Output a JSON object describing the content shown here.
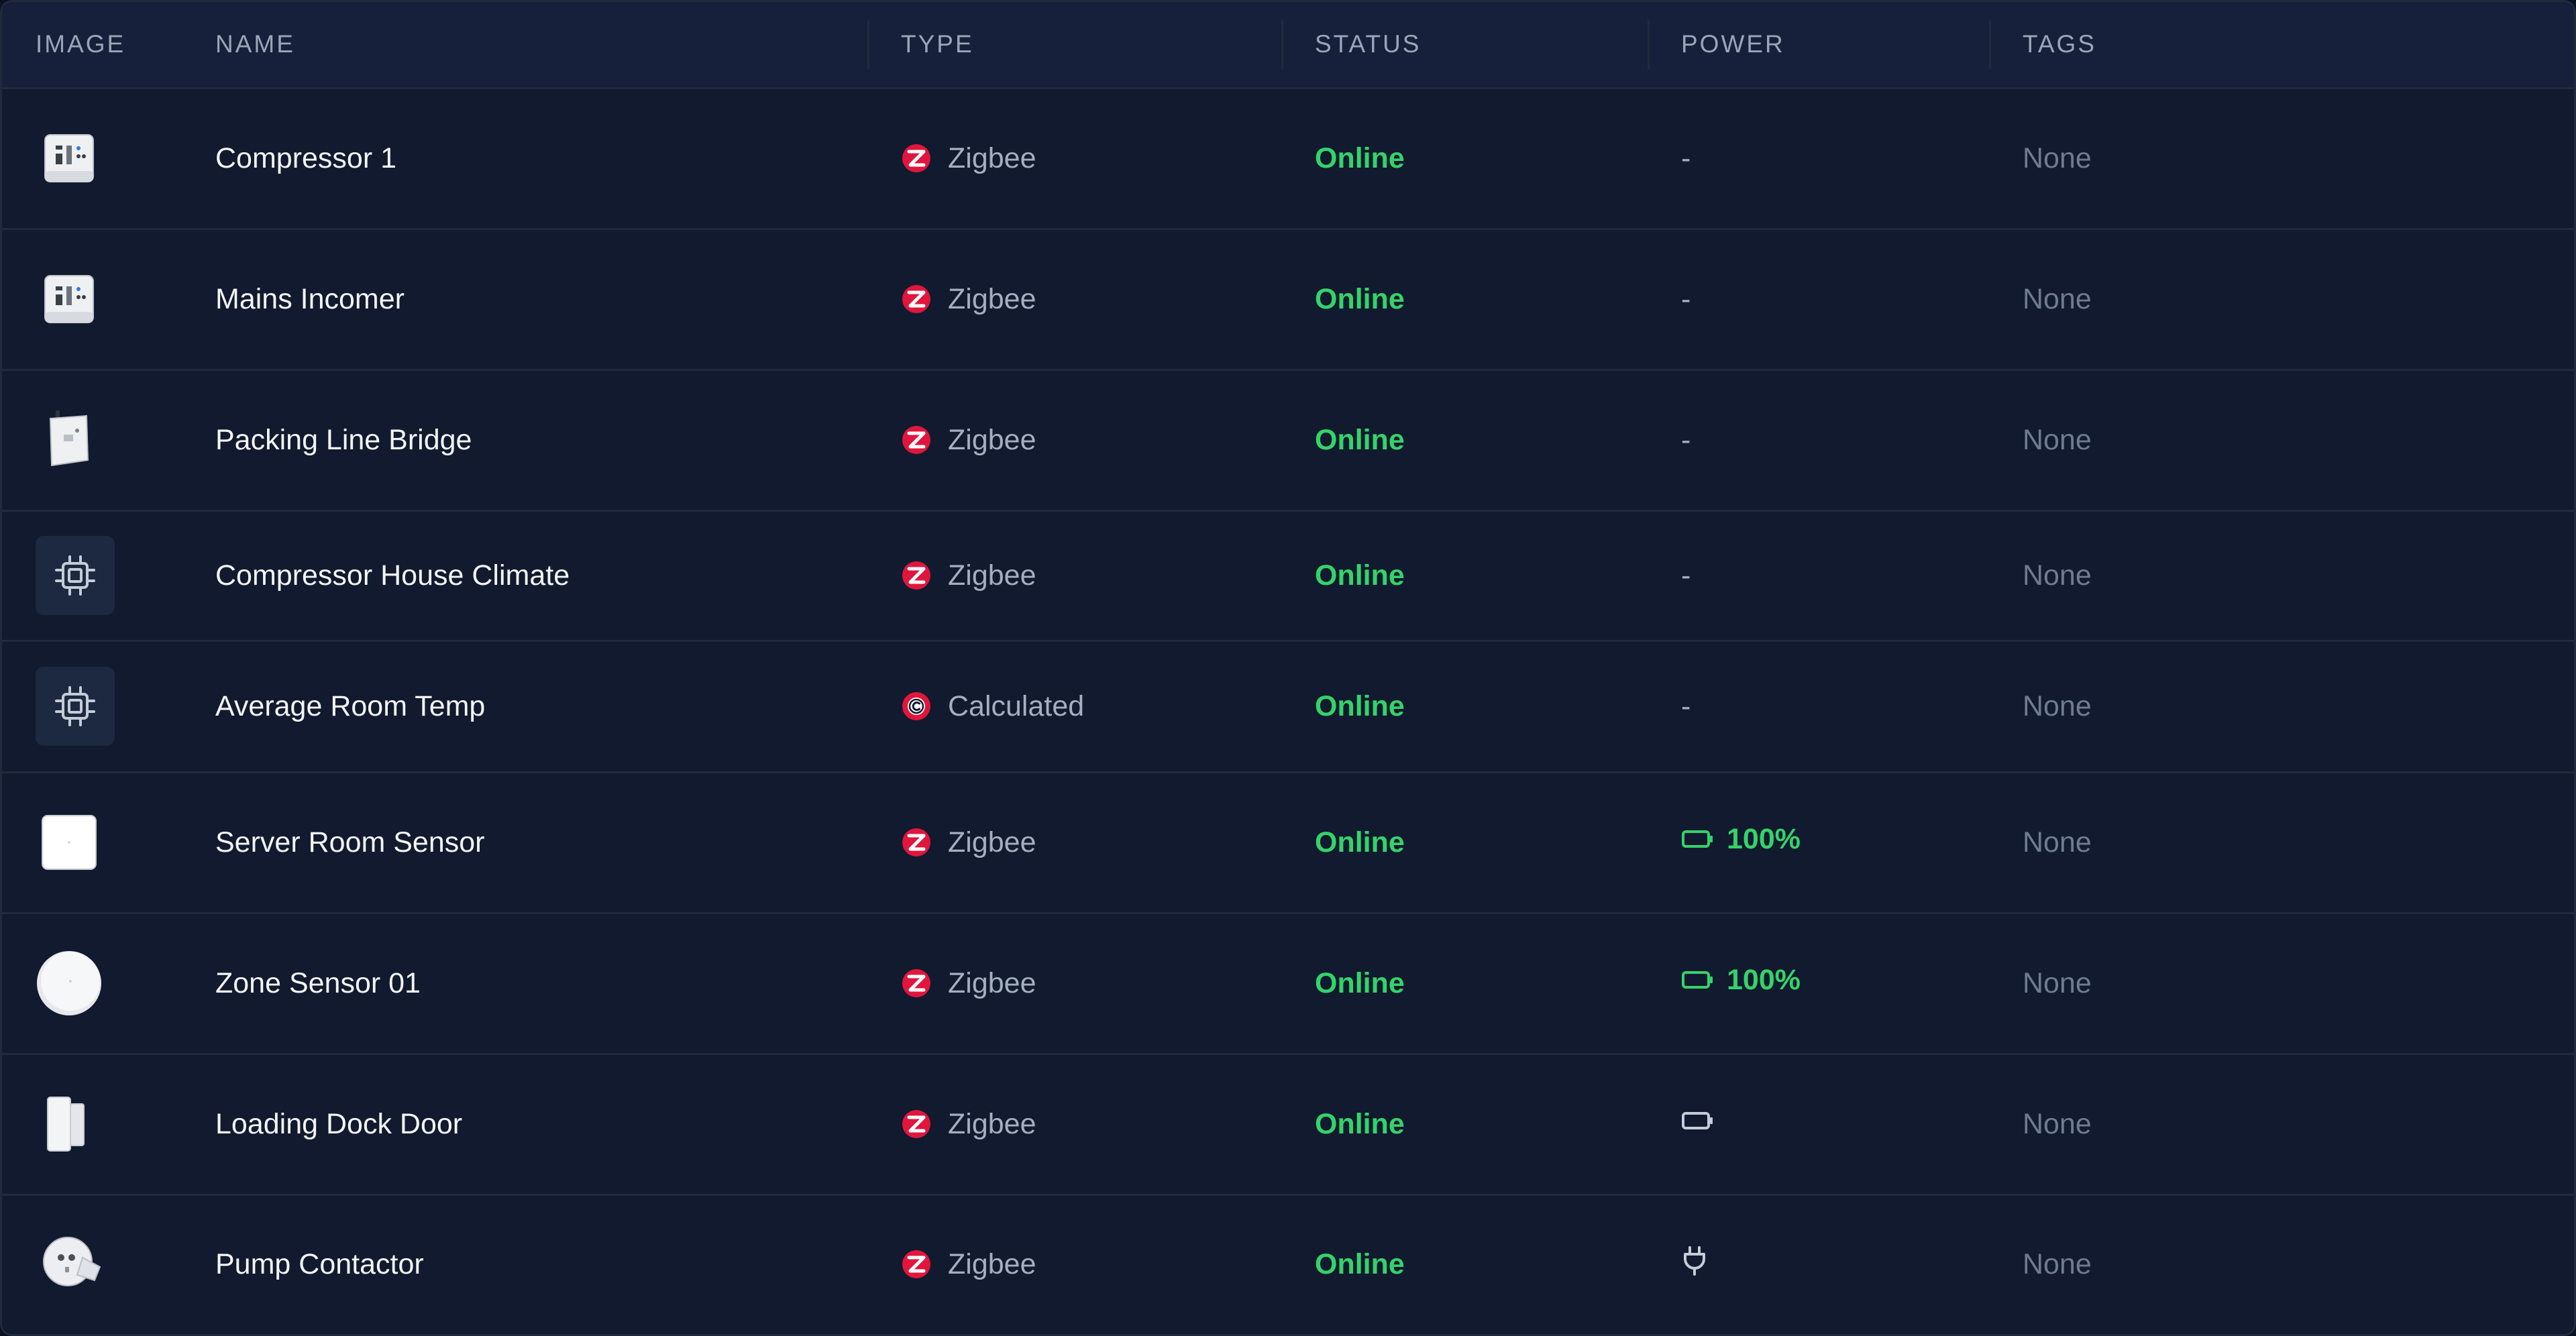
{
  "columns": {
    "image": "IMAGE",
    "name": "NAME",
    "type": "TYPE",
    "status": "STATUS",
    "power": "POWER",
    "tags": "TAGS"
  },
  "colors": {
    "online": "#34d36a",
    "zigbee": "#e0163c",
    "calculated": "#e0163c"
  },
  "rows": [
    {
      "name": "Compressor 1",
      "image": "panel-meter-device",
      "type": "Zigbee",
      "type_icon": "zigbee-icon",
      "status": "Online",
      "power": "-",
      "tags": "None"
    },
    {
      "name": "Mains Incomer",
      "image": "panel-meter-device",
      "type": "Zigbee",
      "type_icon": "zigbee-icon",
      "status": "Online",
      "power": "-",
      "tags": "None"
    },
    {
      "name": "Packing Line Bridge",
      "image": "wall-switch-device",
      "type": "Zigbee",
      "type_icon": "zigbee-icon",
      "status": "Online",
      "power": "-",
      "tags": "None"
    },
    {
      "name": "Compressor House Climate",
      "image": "chip-icon",
      "type": "Zigbee",
      "type_icon": "zigbee-icon",
      "status": "Online",
      "power": "-",
      "tags": "None"
    },
    {
      "name": "Average Room Temp",
      "image": "chip-icon",
      "type": "Calculated",
      "type_icon": "calculated-icon",
      "status": "Online",
      "power": "-",
      "tags": "None"
    },
    {
      "name": "Server Room Sensor",
      "image": "square-sensor-device",
      "type": "Zigbee",
      "type_icon": "zigbee-icon",
      "status": "Online",
      "power": "100%",
      "power_icon": "battery-icon",
      "tags": "None"
    },
    {
      "name": "Zone Sensor 01",
      "image": "round-sensor-device",
      "type": "Zigbee",
      "type_icon": "zigbee-icon",
      "status": "Online",
      "power": "100%",
      "power_icon": "battery-icon",
      "tags": "None"
    },
    {
      "name": "Loading Dock Door",
      "image": "door-sensor-device",
      "type": "Zigbee",
      "type_icon": "zigbee-icon",
      "status": "Online",
      "power": "",
      "power_icon": "battery-icon",
      "tags": "None"
    },
    {
      "name": "Pump Contactor",
      "image": "smart-plug-device",
      "type": "Zigbee",
      "type_icon": "zigbee-icon",
      "status": "Online",
      "power": "",
      "power_icon": "plug-icon",
      "tags": "None"
    }
  ]
}
